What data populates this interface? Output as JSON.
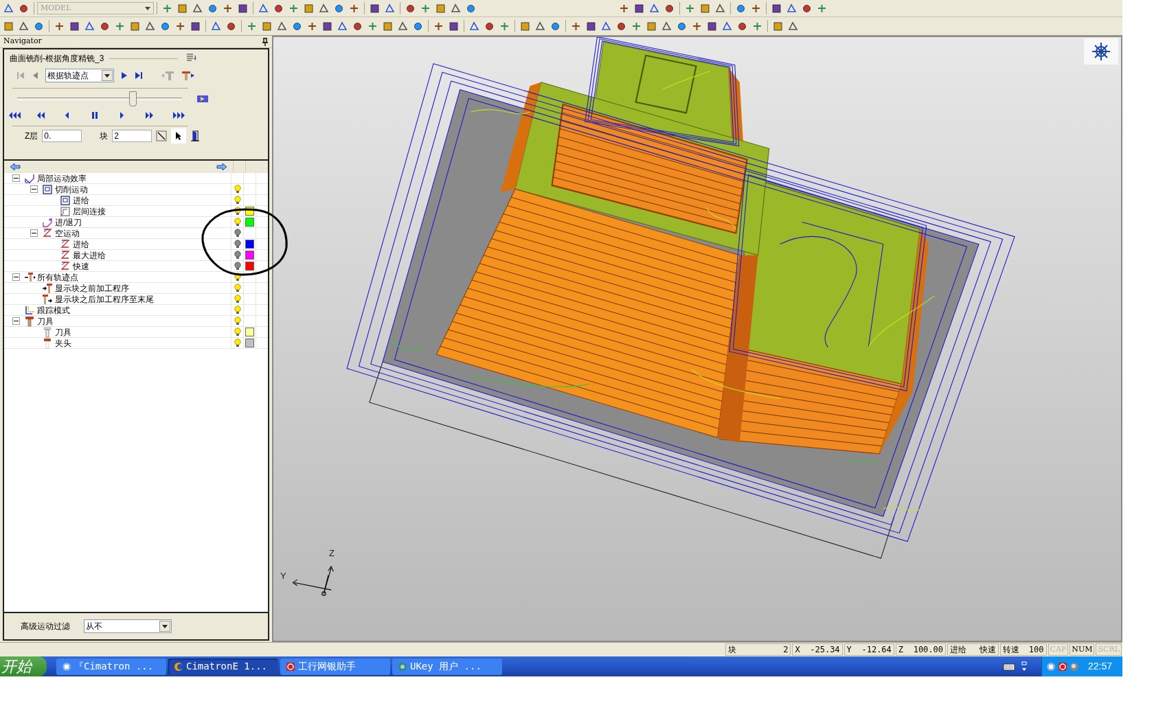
{
  "toolbar": {
    "model_combo": "MODEL"
  },
  "navigator": {
    "title": "Navigator",
    "operation": "曲面铣削-根据角度精铣_3",
    "mode_select": "根据轨迹点",
    "slider": {
      "level": 0.7
    },
    "z_layer_label": "Z层",
    "z_layer_value": "0.",
    "block_label": "块",
    "block_value": "2"
  },
  "tree": [
    {
      "label": "局部运动效率",
      "kind": "motion",
      "expanded": true,
      "children": [
        {
          "label": "切削运动",
          "kind": "cut",
          "lit": true,
          "expanded": true,
          "children": [
            {
              "label": "进给",
              "kind": "cut",
              "lit": true
            },
            {
              "label": "层间连接",
              "kind": "link",
              "lit": true,
              "color": "#ffff00"
            }
          ]
        },
        {
          "label": "进/退刀",
          "kind": "approach",
          "lit": true,
          "color": "#00ff00"
        },
        {
          "label": "空运动",
          "kind": "air",
          "lit": false,
          "expanded": true,
          "children": [
            {
              "label": "进给",
              "kind": "air",
              "lit": false,
              "color": "#0000ff"
            },
            {
              "label": "最大进给",
              "kind": "air",
              "lit": false,
              "color": "#ff00ff"
            },
            {
              "label": "快速",
              "kind": "air",
              "lit": false,
              "color": "#ff0000"
            }
          ]
        }
      ]
    },
    {
      "label": "所有轨迹点",
      "kind": "points",
      "lit": true,
      "expanded": true,
      "children": [
        {
          "label": "显示块之前加工程序",
          "kind": "before",
          "lit": true
        },
        {
          "label": "显示块之后加工程序至末尾",
          "kind": "after",
          "lit": true
        }
      ]
    },
    {
      "label": "跟踪模式",
      "kind": "trace",
      "lit": true
    },
    {
      "label": "刀具",
      "kind": "tool",
      "lit": true,
      "expanded": true,
      "children": [
        {
          "label": "刀具",
          "kind": "cutter",
          "lit": true,
          "color": "#ffff99"
        },
        {
          "label": "夹头",
          "kind": "holder",
          "lit": true,
          "color": "#c0c0c0"
        }
      ]
    }
  ],
  "filter": {
    "label": "高级运动过滤",
    "value": "从不"
  },
  "viewport": {
    "axis_z": "Z",
    "axis_y": "Y"
  },
  "status_bar": [
    {
      "kind": "field",
      "label": "块",
      "value": "2"
    },
    {
      "kind": "field",
      "label": "X",
      "value": "-25.34"
    },
    {
      "kind": "field",
      "label": "Y",
      "value": "-12.64"
    },
    {
      "kind": "field",
      "label": "Z",
      "value": "100.00"
    },
    {
      "kind": "field",
      "label": "进给",
      "value": "快速"
    },
    {
      "kind": "field",
      "label": "转速",
      "value": "100"
    },
    {
      "kind": "indicator",
      "label": "CAP",
      "on": false
    },
    {
      "kind": "indicator",
      "label": "NUM",
      "on": true
    },
    {
      "kind": "indicator",
      "label": "SCRL",
      "on": false
    }
  ],
  "taskbar": {
    "start": "开始",
    "tasks": [
      {
        "label": "『Cimatron ...",
        "selected": false
      },
      {
        "label": "CimatronE 1...",
        "selected": true
      },
      {
        "label": "工行网银助手",
        "selected": false
      },
      {
        "label": "UKey 用户 ...",
        "selected": false
      }
    ],
    "clock": "22:57"
  }
}
